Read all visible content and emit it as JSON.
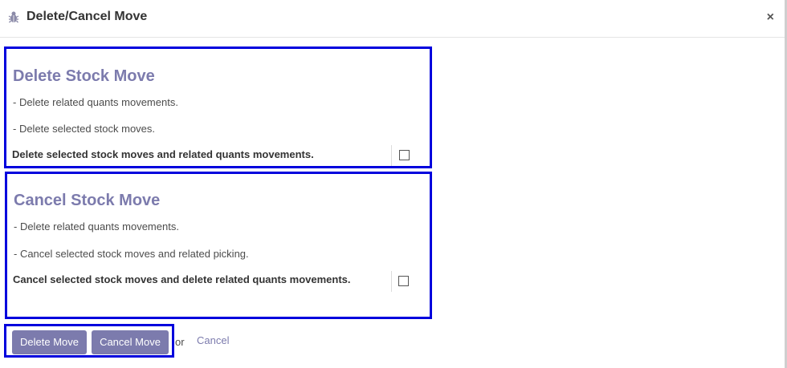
{
  "dialog": {
    "title": "Delete/Cancel Move",
    "close_symbol": "×",
    "icon": "bug-icon"
  },
  "delete_section": {
    "title": "Delete Stock Move",
    "lines": [
      "- Delete related quants movements.",
      "- Delete selected stock moves."
    ],
    "checkbox_label": "Delete selected stock moves and related quants movements.",
    "checked": false
  },
  "cancel_section": {
    "title": "Cancel Stock Move",
    "lines": [
      "- Delete related quants movements.",
      "- Cancel selected stock moves and related picking."
    ],
    "checkbox_label": "Cancel selected stock moves and delete related quants movements.",
    "checked": false
  },
  "footer": {
    "delete_button": "Delete Move",
    "cancel_move_button": "Cancel Move",
    "or_text": "or",
    "cancel_link": "Cancel"
  },
  "colors": {
    "accent": "#7c7bad",
    "highlight_border": "#0000dd"
  }
}
